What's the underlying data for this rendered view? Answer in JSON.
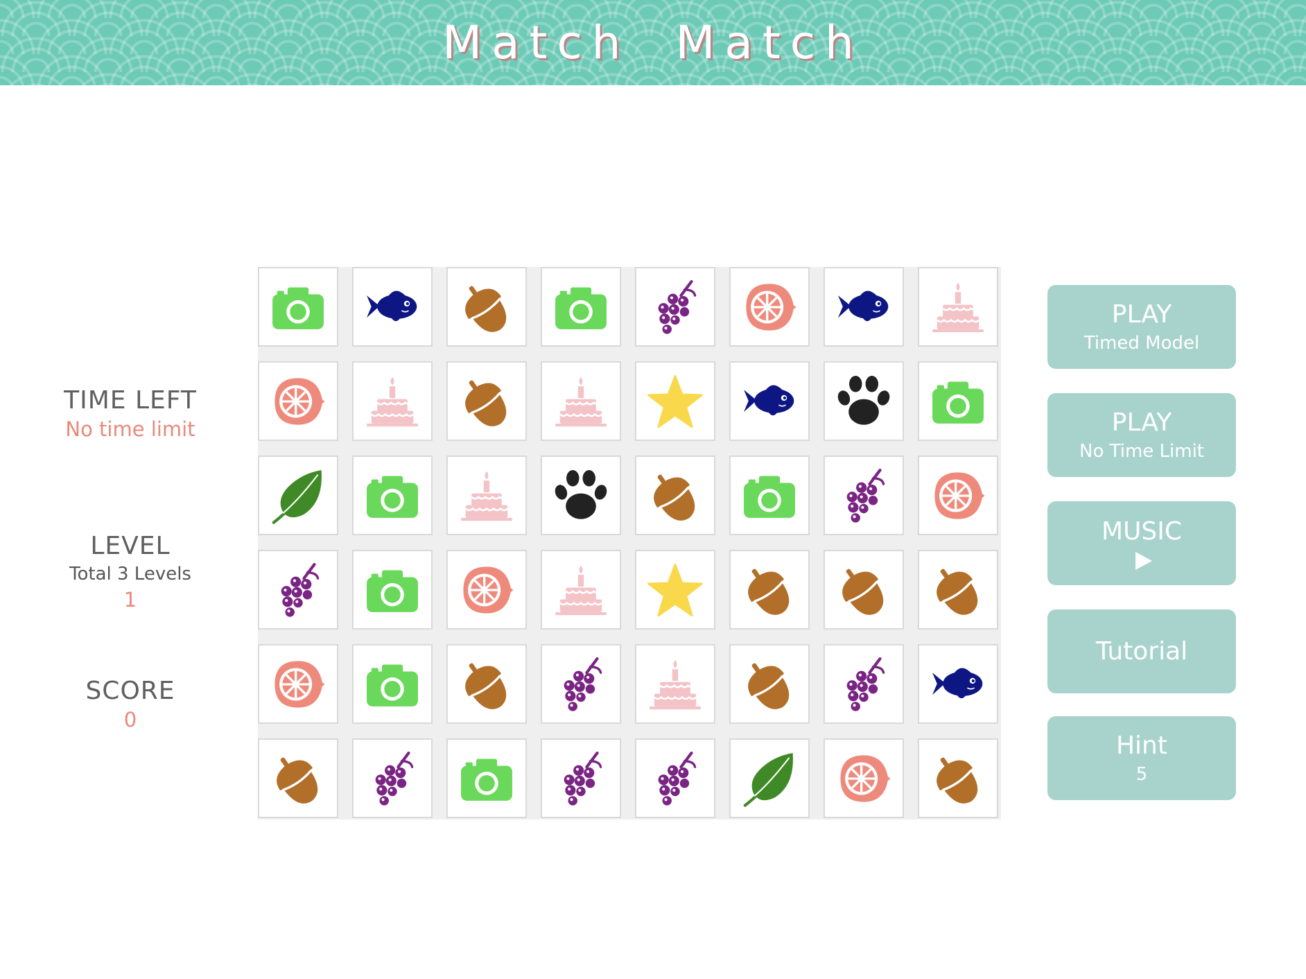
{
  "header": {
    "title": "Match Match"
  },
  "stats": {
    "time_left": {
      "label": "TIME LEFT",
      "value": "No time limit"
    },
    "level": {
      "label": "LEVEL",
      "subtitle": "Total 3 Levels",
      "value": "1"
    },
    "score": {
      "label": "SCORE",
      "value": "0"
    }
  },
  "board": {
    "rows": [
      [
        "camera-icon",
        "fish-icon",
        "acorn-icon",
        "camera-icon",
        "grapes-icon",
        "citrus-icon",
        "fish-icon",
        "cake-icon"
      ],
      [
        "citrus-icon",
        "cake-icon",
        "acorn-icon",
        "cake-icon",
        "star-icon",
        "fish-icon",
        "paw-icon",
        "camera-icon"
      ],
      [
        "leaf-icon",
        "camera-icon",
        "cake-icon",
        "paw-icon",
        "acorn-icon",
        "camera-icon",
        "grapes-icon",
        "citrus-icon"
      ],
      [
        "grapes-icon",
        "camera-icon",
        "citrus-icon",
        "cake-icon",
        "star-icon",
        "acorn-icon",
        "acorn-icon",
        "acorn-icon"
      ],
      [
        "citrus-icon",
        "camera-icon",
        "acorn-icon",
        "grapes-icon",
        "cake-icon",
        "acorn-icon",
        "grapes-icon",
        "fish-icon"
      ],
      [
        "acorn-icon",
        "grapes-icon",
        "camera-icon",
        "grapes-icon",
        "grapes-icon",
        "leaf-icon",
        "citrus-icon",
        "acorn-icon"
      ]
    ]
  },
  "buttons": {
    "play_timed": {
      "label": "PLAY",
      "sub": "Timed Model"
    },
    "play_no_limit": {
      "label": "PLAY",
      "sub": "No Time Limit"
    },
    "music": {
      "label": "MUSIC",
      "icon": "play-icon"
    },
    "tutorial": {
      "label": "Tutorial"
    },
    "hint": {
      "label": "Hint",
      "count": "5"
    }
  },
  "colors": {
    "header_bg": "#6dcab7",
    "button_bg": "#a8d3cd",
    "accent_value": "#e8897a",
    "camera": "#6ad85a",
    "fish": "#0d1683",
    "acorn": "#b16f2a",
    "grapes": "#7a2484",
    "citrus": "#ee8a7c",
    "cake": "#f3c3c8",
    "star": "#f9d84b",
    "paw": "#222222",
    "leaf": "#3f8a26"
  }
}
